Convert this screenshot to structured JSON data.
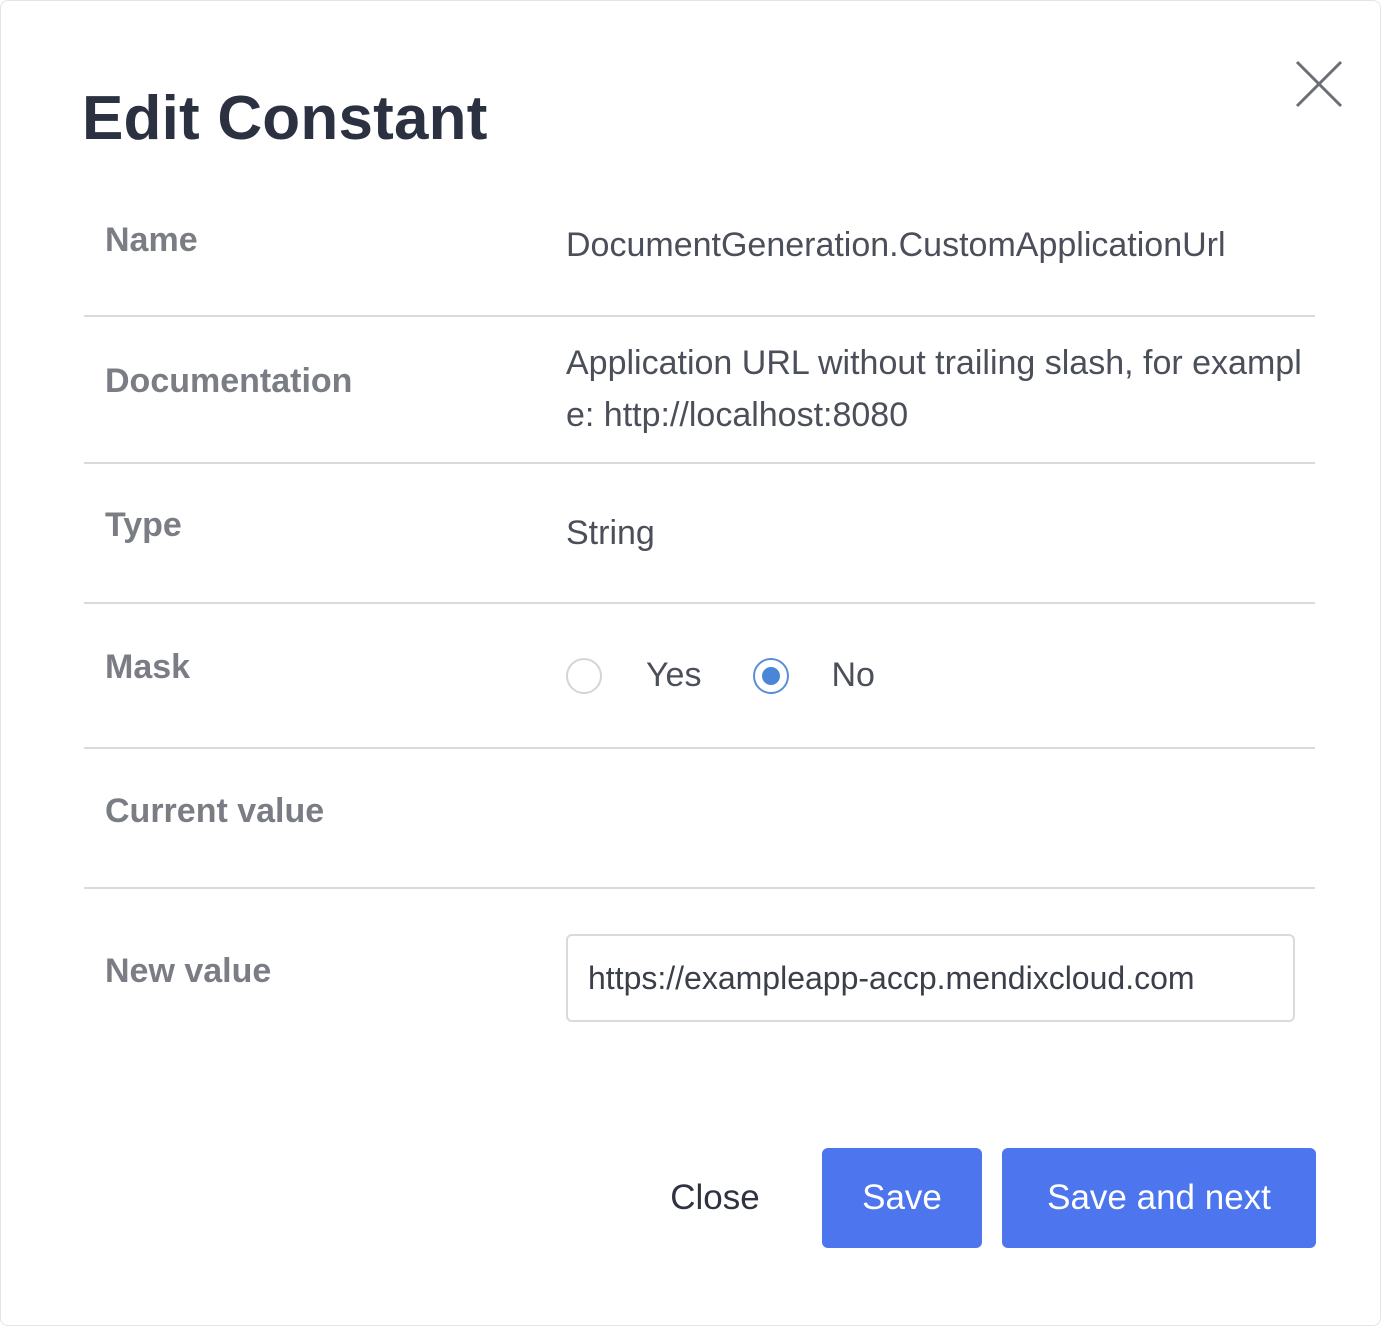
{
  "dialog": {
    "title": "Edit Constant",
    "close_icon": "close-icon"
  },
  "fields": {
    "name": {
      "label": "Name",
      "value": "DocumentGeneration.CustomApplicationUrl"
    },
    "documentation": {
      "label": "Documentation",
      "value": "Application URL without trailing slash, for example: http://localhost:8080"
    },
    "type": {
      "label": "Type",
      "value": "String"
    },
    "mask": {
      "label": "Mask",
      "options": [
        "Yes",
        "No"
      ],
      "selected": "No"
    },
    "current_value": {
      "label": "Current value",
      "value": ""
    },
    "new_value": {
      "label": "New value",
      "value": "https://exampleapp-accp.mendixcloud.com",
      "placeholder": ""
    }
  },
  "buttons": {
    "close": "Close",
    "save": "Save",
    "save_and_next": "Save and next"
  },
  "colors": {
    "primary": "#4c75ee",
    "radio_selected": "#4a86d8",
    "divider": "#d9dadd"
  }
}
